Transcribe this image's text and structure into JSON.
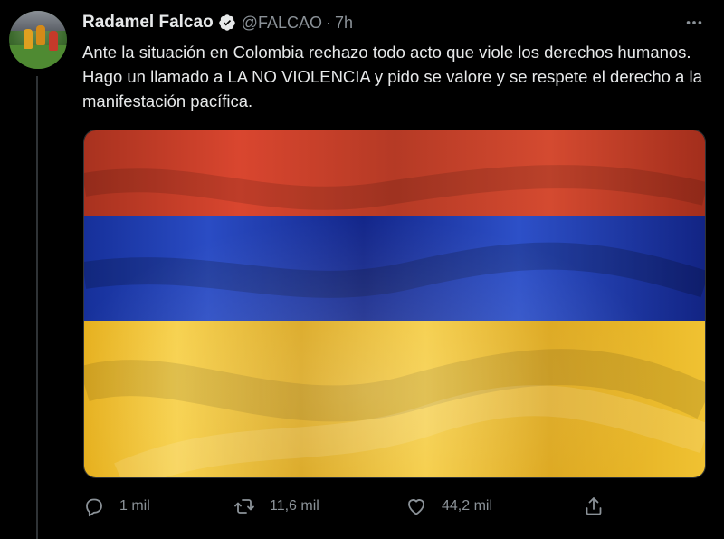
{
  "author": {
    "name": "Radamel Falcao",
    "handle": "@FALCAO",
    "separator": "·",
    "time": "7h",
    "verified": true
  },
  "tweet": {
    "text": "Ante la situación en Colombia rechazo todo acto que viole los derechos humanos.  Hago un llamado a LA NO VIOLENCIA y pido se valore y se respete el derecho a la manifestación pacífica."
  },
  "media": {
    "description_icon": "flag-image",
    "stripes": [
      {
        "color": "#c0392b"
      },
      {
        "color": "#1f3fa8"
      },
      {
        "color": "#f2c230"
      }
    ]
  },
  "actions": {
    "reply": {
      "icon": "reply-icon",
      "count": "1 mil"
    },
    "retweet": {
      "icon": "retweet-icon",
      "count": "11,6 mil"
    },
    "like": {
      "icon": "heart-icon",
      "count": "44,2 mil"
    },
    "share": {
      "icon": "share-icon"
    }
  },
  "colors": {
    "background": "#000000",
    "text": "#e7e9ea",
    "muted": "#8b9298",
    "verified": "#e7e9ea"
  }
}
